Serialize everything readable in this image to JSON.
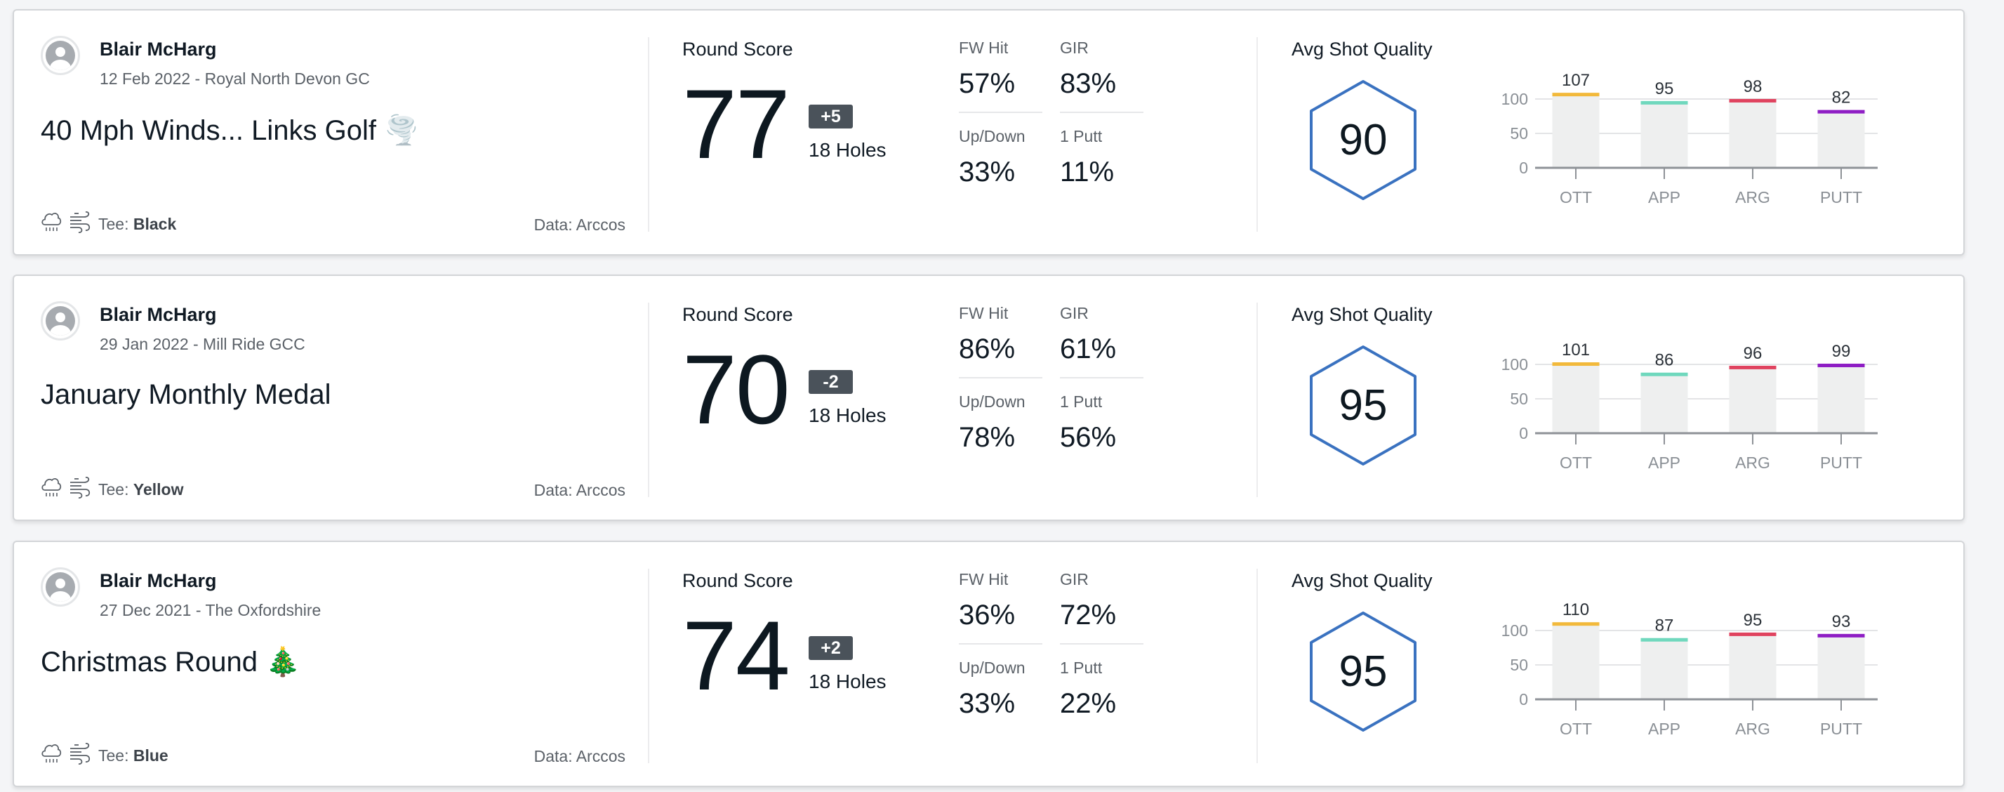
{
  "rounds": [
    {
      "player": "Blair McHarg",
      "date_course": "12 Feb 2022 - Royal North Devon GC",
      "title": "40 Mph Winds... Links Golf 🌪️",
      "tee_label": "Tee:",
      "tee": "Black",
      "data_source": "Data: Arccos",
      "round_score_label": "Round Score",
      "score": "77",
      "to_par": "+5",
      "holes": "18 Holes",
      "stats": [
        {
          "label": "FW Hit",
          "value": "57%"
        },
        {
          "label": "GIR",
          "value": "83%"
        },
        {
          "label": "Up/Down",
          "value": "33%"
        },
        {
          "label": "1 Putt",
          "value": "11%"
        }
      ],
      "avg_shot_quality_label": "Avg Shot Quality",
      "avg_shot_quality": "90",
      "weather_icons": [
        "rain-cloud-icon",
        "wind-icon"
      ]
    },
    {
      "player": "Blair McHarg",
      "date_course": "29 Jan 2022 - Mill Ride GCC",
      "title": "January Monthly Medal",
      "tee_label": "Tee:",
      "tee": "Yellow",
      "data_source": "Data: Arccos",
      "round_score_label": "Round Score",
      "score": "70",
      "to_par": "-2",
      "holes": "18 Holes",
      "stats": [
        {
          "label": "FW Hit",
          "value": "86%"
        },
        {
          "label": "GIR",
          "value": "61%"
        },
        {
          "label": "Up/Down",
          "value": "78%"
        },
        {
          "label": "1 Putt",
          "value": "56%"
        }
      ],
      "avg_shot_quality_label": "Avg Shot Quality",
      "avg_shot_quality": "95",
      "weather_icons": [
        "rain-cloud-icon",
        "wind-icon"
      ]
    },
    {
      "player": "Blair McHarg",
      "date_course": "27 Dec 2021 - The Oxfordshire",
      "title": "Christmas Round 🎄",
      "tee_label": "Tee:",
      "tee": "Blue",
      "data_source": "Data: Arccos",
      "round_score_label": "Round Score",
      "score": "74",
      "to_par": "+2",
      "holes": "18 Holes",
      "stats": [
        {
          "label": "FW Hit",
          "value": "36%"
        },
        {
          "label": "GIR",
          "value": "72%"
        },
        {
          "label": "Up/Down",
          "value": "33%"
        },
        {
          "label": "1 Putt",
          "value": "22%"
        }
      ],
      "avg_shot_quality_label": "Avg Shot Quality",
      "avg_shot_quality": "95",
      "weather_icons": [
        "rain-cloud-icon",
        "wind-icon"
      ]
    }
  ],
  "colors": {
    "OTT": "#f2b93b",
    "APP": "#6fd8bd",
    "ARG": "#e0435f",
    "PUTT": "#8e1dc4",
    "bar_bg": "#eeefef",
    "hexagon": "#3a72c0",
    "badge": "#4a525a"
  },
  "chart_data": [
    {
      "type": "bar",
      "title": "Avg Shot Quality",
      "categories": [
        "OTT",
        "APP",
        "ARG",
        "PUTT"
      ],
      "values": [
        107,
        95,
        98,
        82
      ],
      "yticks": [
        0,
        50,
        100
      ],
      "ylim": [
        0,
        100
      ],
      "grid": true
    },
    {
      "type": "bar",
      "title": "Avg Shot Quality",
      "categories": [
        "OTT",
        "APP",
        "ARG",
        "PUTT"
      ],
      "values": [
        101,
        86,
        96,
        99
      ],
      "yticks": [
        0,
        50,
        100
      ],
      "ylim": [
        0,
        100
      ],
      "grid": true
    },
    {
      "type": "bar",
      "title": "Avg Shot Quality",
      "categories": [
        "OTT",
        "APP",
        "ARG",
        "PUTT"
      ],
      "values": [
        110,
        87,
        95,
        93
      ],
      "yticks": [
        0,
        50,
        100
      ],
      "ylim": [
        0,
        100
      ],
      "grid": true
    }
  ]
}
